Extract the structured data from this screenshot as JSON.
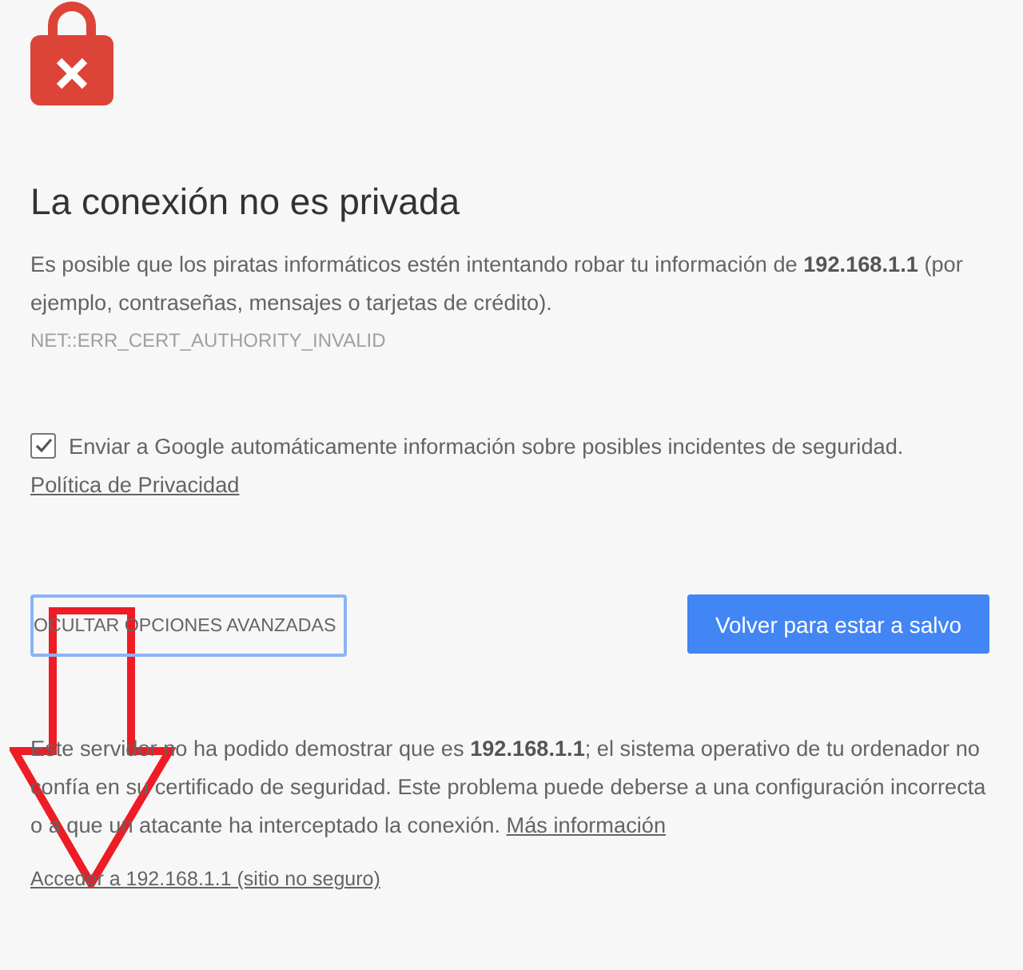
{
  "title": "La conexión no es privada",
  "intro": "Es posible que los piratas informáticos estén intentando robar tu información de **192.168.1.1** (por ejemplo, contraseñas, mensajes o tarjetas de crédito).",
  "error_code": "NET::ERR_CERT_AUTHORITY_INVALID",
  "report": {
    "checked": true,
    "text": "Enviar a Google automáticamente información sobre posibles incidentes de seguridad.",
    "link": "Política de Privacidad"
  },
  "buttons": {
    "secondary": "OCULTAR OPCIONES AVANZADAS",
    "primary": "Volver para estar a salvo"
  },
  "details": {
    "text": "Este servidor no ha podido demostrar que es **192.168.1.1**; el sistema operativo de tu ordenador no confía en su certificado de seguridad. Este problema puede deberse a una configuración incorrecta o a que un atacante ha interceptado la conexión.",
    "link": "Más información"
  },
  "proceed_link": "Acceder a 192.168.1.1 (sitio no seguro)"
}
